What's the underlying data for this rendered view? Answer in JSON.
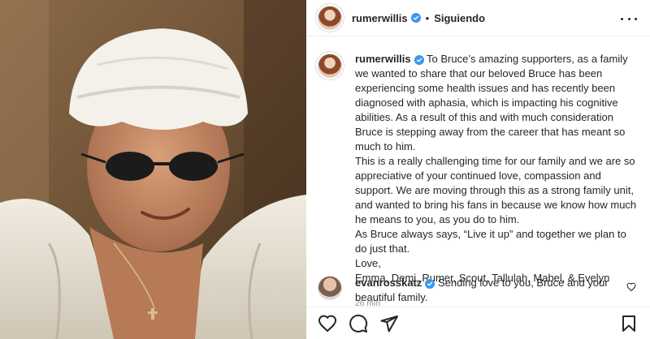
{
  "header": {
    "username": "rumerwillis",
    "separator": "•",
    "follow_status": "Siguiendo",
    "more_icon": "more-horizontal-icon",
    "verified_icon": "verified-badge-icon"
  },
  "caption": {
    "username": "rumerwillis",
    "paragraphs": [
      "To Bruce’s amazing supporters, as a family we wanted to share that our beloved Bruce has been experiencing some health issues and has recently been diagnosed with aphasia, which is impacting his cognitive abilities. As a result of this and with much consideration Bruce is stepping away from the career that has meant so much to him.",
      "This is a really challenging time for our family and we are so appreciative of your continued love, compassion and support. We are moving through this as a strong family unit, and wanted to bring his fans in because we know how much he means to you, as you do to him.",
      "As Bruce always says, “Live it up” and together we plan to do just that.",
      "Love,",
      "Emma, Demi, Rumer, Scout, Tallulah, Mabel, & Evelyn"
    ],
    "timestamp": "26 min"
  },
  "comment": {
    "username": "evanrosskatz",
    "text": "Sending love to you, Bruce and your beautiful family.",
    "like_icon": "heart-outline-icon"
  },
  "actions": {
    "like_icon": "heart-outline-icon",
    "comment_icon": "comment-bubble-icon",
    "share_icon": "paper-plane-icon",
    "save_icon": "bookmark-icon"
  },
  "colors": {
    "verified_blue": "#3897f0",
    "text_primary": "#262626",
    "text_secondary": "#8e8e8e",
    "divider": "#efefef"
  }
}
